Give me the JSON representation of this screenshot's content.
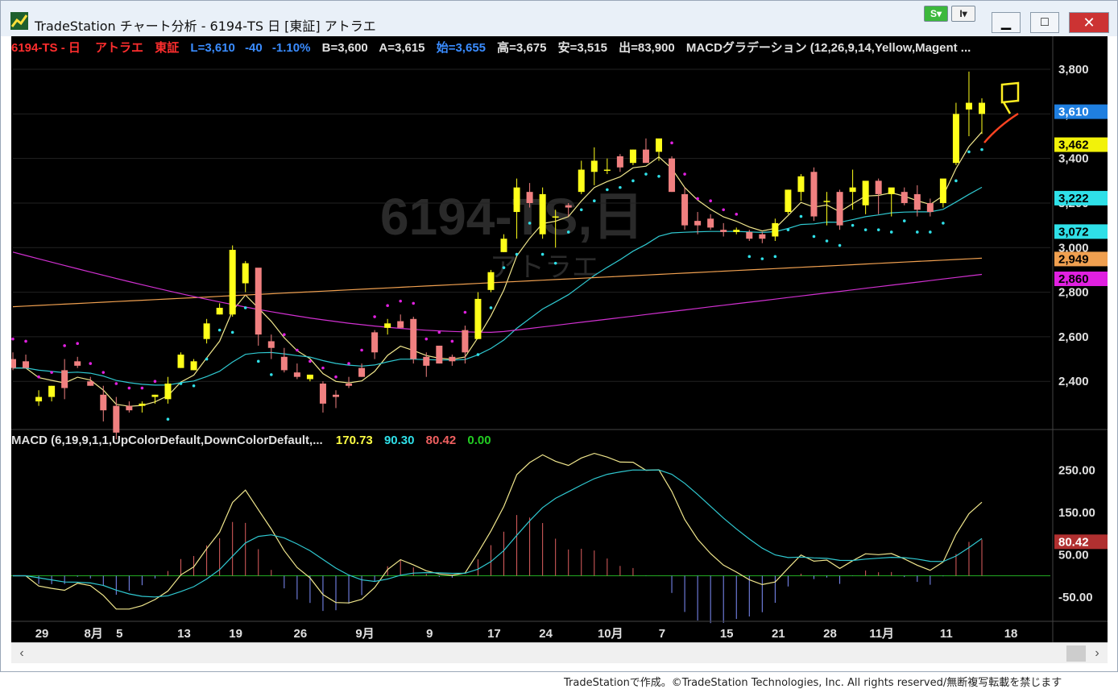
{
  "window": {
    "title": "TradeStation チャート分析 - 6194-TS 日 [東証] アトラエ",
    "badge_s": "S",
    "badge_i": "I",
    "min_glyph": "▁",
    "max_glyph": "□",
    "close_glyph": "✕"
  },
  "header": {
    "symbol": "6194-TS - 日",
    "name": "アトラエ",
    "exchange": "東証",
    "last": "L=3,610",
    "change": "-40",
    "change_pct": "-1.10%",
    "bid": "B=3,600",
    "ask": "A=3,615",
    "open": "始=3,655",
    "high": "高=3,675",
    "low": "安=3,515",
    "volume": "出=83,900",
    "indicator": "MACDグラデーション (12,26,9,14,Yellow,Magent ..."
  },
  "watermark": {
    "symbol": "6194-TS,日",
    "name": "アトラエ"
  },
  "price_axis": {
    "ticks": [
      "3,800",
      "3,600",
      "3,400",
      "3,200",
      "3,000",
      "2,800",
      "2,600",
      "2,400"
    ],
    "tags": [
      {
        "label": "3,610",
        "color": "#1f7fe0",
        "text_color": "#ffffff"
      },
      {
        "label": "3,462",
        "color": "#f2f20a",
        "text_color": "#000000"
      },
      {
        "label": "3,222",
        "color": "#2fe0e8",
        "text_color": "#000000"
      },
      {
        "label": "3,072",
        "color": "#2fe0e8",
        "text_color": "#000000"
      },
      {
        "label": "2,949",
        "color": "#f0a050",
        "text_color": "#000000"
      },
      {
        "label": "2,860",
        "color": "#e020e0",
        "text_color": "#000000"
      }
    ]
  },
  "macd_panel": {
    "label": "MACD (6,19,9,1,1,UpColorDefault,DownColorDefault,...",
    "macd_value": "170.73",
    "signal_value": "90.30",
    "hist_value": "80.42",
    "zero_value": "0.00",
    "ticks": [
      "250.00",
      "150.00",
      "50.00",
      "-50.00"
    ],
    "tag": "80.42"
  },
  "date_axis": [
    "29",
    "8月",
    "5",
    "13",
    "19",
    "26",
    "9月",
    "9",
    "17",
    "24",
    "10月",
    "7",
    "15",
    "21",
    "28",
    "11月",
    "11",
    "18"
  ],
  "footer": "TradeStationで作成。©TradeStation Technologies, Inc. All rights reserved/無断複写転載を禁じます",
  "colors": {
    "up": "#ffff1a",
    "down": "#f08080",
    "psar": "#e020e0",
    "psar_up": "#2fe0e8",
    "ema_fast": "#f0e68c",
    "ema_mid": "#2fc8d0",
    "ema_slow": "#f0a050",
    "ema_long": "#d030d0"
  },
  "chart_data": {
    "type": "candlestick",
    "candles": [
      {
        "o": 2500,
        "h": 2530,
        "l": 2450,
        "c": 2460
      },
      {
        "o": 2490,
        "h": 2520,
        "l": 2460,
        "c": 2460
      },
      {
        "o": 2310,
        "h": 2360,
        "l": 2290,
        "c": 2330
      },
      {
        "o": 2330,
        "h": 2380,
        "l": 2310,
        "c": 2380
      },
      {
        "o": 2450,
        "h": 2500,
        "l": 2320,
        "c": 2370
      },
      {
        "o": 2490,
        "h": 2510,
        "l": 2460,
        "c": 2470
      },
      {
        "o": 2400,
        "h": 2420,
        "l": 2380,
        "c": 2380
      },
      {
        "o": 2340,
        "h": 2380,
        "l": 2220,
        "c": 2270
      },
      {
        "o": 2290,
        "h": 2330,
        "l": 2140,
        "c": 2170
      },
      {
        "o": 2290,
        "h": 2310,
        "l": 2260,
        "c": 2270
      },
      {
        "o": 2290,
        "h": 2310,
        "l": 2260,
        "c": 2300
      },
      {
        "o": 2330,
        "h": 2340,
        "l": 2300,
        "c": 2340
      },
      {
        "o": 2320,
        "h": 2420,
        "l": 2300,
        "c": 2390
      },
      {
        "o": 2460,
        "h": 2530,
        "l": 2460,
        "c": 2520
      },
      {
        "o": 2450,
        "h": 2500,
        "l": 2450,
        "c": 2490
      },
      {
        "o": 2590,
        "h": 2680,
        "l": 2570,
        "c": 2660
      },
      {
        "o": 2700,
        "h": 2750,
        "l": 2700,
        "c": 2730
      },
      {
        "o": 2700,
        "h": 3010,
        "l": 2690,
        "c": 2990
      },
      {
        "o": 2840,
        "h": 2940,
        "l": 2800,
        "c": 2930
      },
      {
        "o": 2910,
        "h": 2870,
        "l": 2560,
        "c": 2610
      },
      {
        "o": 2580,
        "h": 2610,
        "l": 2500,
        "c": 2550
      },
      {
        "o": 2510,
        "h": 2550,
        "l": 2440,
        "c": 2450
      },
      {
        "o": 2440,
        "h": 2480,
        "l": 2410,
        "c": 2420
      },
      {
        "o": 2410,
        "h": 2430,
        "l": 2400,
        "c": 2430
      },
      {
        "o": 2390,
        "h": 2400,
        "l": 2260,
        "c": 2300
      },
      {
        "o": 2340,
        "h": 2360,
        "l": 2280,
        "c": 2330
      },
      {
        "o": 2390,
        "h": 2420,
        "l": 2370,
        "c": 2380
      },
      {
        "o": 2460,
        "h": 2480,
        "l": 2420,
        "c": 2420
      },
      {
        "o": 2620,
        "h": 2630,
        "l": 2500,
        "c": 2530
      },
      {
        "o": 2640,
        "h": 2680,
        "l": 2610,
        "c": 2660
      },
      {
        "o": 2670,
        "h": 2700,
        "l": 2640,
        "c": 2640
      },
      {
        "o": 2680,
        "h": 2690,
        "l": 2480,
        "c": 2500
      },
      {
        "o": 2510,
        "h": 2530,
        "l": 2420,
        "c": 2470
      },
      {
        "o": 2560,
        "h": 2560,
        "l": 2480,
        "c": 2480
      },
      {
        "o": 2510,
        "h": 2520,
        "l": 2470,
        "c": 2490
      },
      {
        "o": 2630,
        "h": 2650,
        "l": 2480,
        "c": 2530
      },
      {
        "o": 2590,
        "h": 2800,
        "l": 2590,
        "c": 2770
      },
      {
        "o": 2810,
        "h": 2900,
        "l": 2800,
        "c": 2890
      },
      {
        "o": 2980,
        "h": 3060,
        "l": 2980,
        "c": 3040
      },
      {
        "o": 3160,
        "h": 3310,
        "l": 3040,
        "c": 3270
      },
      {
        "o": 3250,
        "h": 3290,
        "l": 3180,
        "c": 3200
      },
      {
        "o": 3060,
        "h": 3270,
        "l": 3040,
        "c": 3240
      },
      {
        "o": 3140,
        "h": 3170,
        "l": 3000,
        "c": 3140
      },
      {
        "o": 3190,
        "h": 3200,
        "l": 3140,
        "c": 3180
      },
      {
        "o": 3250,
        "h": 3390,
        "l": 3240,
        "c": 3350
      },
      {
        "o": 3340,
        "h": 3450,
        "l": 3280,
        "c": 3390
      },
      {
        "o": 3350,
        "h": 3400,
        "l": 3330,
        "c": 3350
      },
      {
        "o": 3410,
        "h": 3420,
        "l": 3340,
        "c": 3360
      },
      {
        "o": 3380,
        "h": 3440,
        "l": 3370,
        "c": 3440
      },
      {
        "o": 3440,
        "h": 3490,
        "l": 3400,
        "c": 3380
      },
      {
        "o": 3430,
        "h": 3470,
        "l": 3390,
        "c": 3490
      },
      {
        "o": 3400,
        "h": 3410,
        "l": 3250,
        "c": 3250
      },
      {
        "o": 3240,
        "h": 3270,
        "l": 3080,
        "c": 3100
      },
      {
        "o": 3120,
        "h": 3160,
        "l": 3060,
        "c": 3100
      },
      {
        "o": 3130,
        "h": 3150,
        "l": 3080,
        "c": 3090
      },
      {
        "o": 3080,
        "h": 3110,
        "l": 3050,
        "c": 3070
      },
      {
        "o": 3070,
        "h": 3090,
        "l": 3060,
        "c": 3080
      },
      {
        "o": 3070,
        "h": 3080,
        "l": 3030,
        "c": 3040
      },
      {
        "o": 3060,
        "h": 3070,
        "l": 3020,
        "c": 3040
      },
      {
        "o": 3050,
        "h": 3130,
        "l": 3030,
        "c": 3110
      },
      {
        "o": 3160,
        "h": 3260,
        "l": 3150,
        "c": 3260
      },
      {
        "o": 3250,
        "h": 3330,
        "l": 3210,
        "c": 3320
      },
      {
        "o": 3340,
        "h": 3360,
        "l": 3120,
        "c": 3140
      },
      {
        "o": 3210,
        "h": 3250,
        "l": 3100,
        "c": 3210
      },
      {
        "o": 3250,
        "h": 3260,
        "l": 3080,
        "c": 3100
      },
      {
        "o": 3250,
        "h": 3350,
        "l": 3170,
        "c": 3270
      },
      {
        "o": 3190,
        "h": 3290,
        "l": 3150,
        "c": 3300
      },
      {
        "o": 3300,
        "h": 3310,
        "l": 3150,
        "c": 3240
      },
      {
        "o": 3240,
        "h": 3260,
        "l": 3140,
        "c": 3270
      },
      {
        "o": 3250,
        "h": 3270,
        "l": 3190,
        "c": 3200
      },
      {
        "o": 3240,
        "h": 3280,
        "l": 3140,
        "c": 3170
      },
      {
        "o": 3200,
        "h": 3220,
        "l": 3140,
        "c": 3160
      },
      {
        "o": 3200,
        "h": 3300,
        "l": 3180,
        "c": 3310
      },
      {
        "o": 3380,
        "h": 3650,
        "l": 3370,
        "c": 3600
      },
      {
        "o": 3620,
        "h": 3790,
        "l": 3500,
        "c": 3650
      },
      {
        "o": 3600,
        "h": 3670,
        "l": 3510,
        "c": 3650
      }
    ],
    "price_range": [
      2220,
      3840
    ],
    "macd_range": [
      -100,
      300
    ]
  }
}
